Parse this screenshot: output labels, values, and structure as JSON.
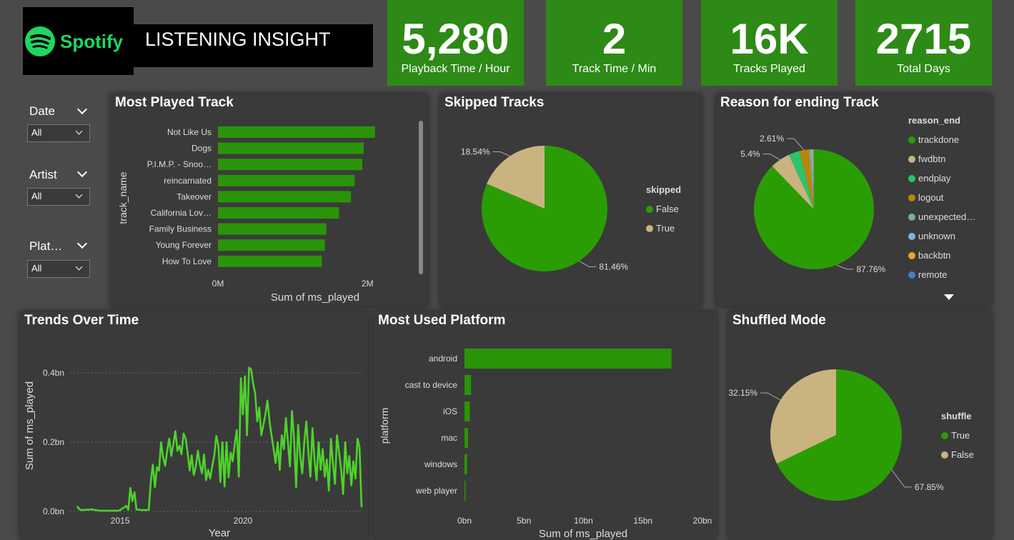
{
  "header": {
    "brand": "Spotify",
    "title": "LISTENING INSIGHT"
  },
  "kpis": [
    {
      "value": "5,280",
      "label": "Playback Time / Hour"
    },
    {
      "value": "2",
      "label": "Track Time / Min"
    },
    {
      "value": "16K",
      "label": "Tracks Played"
    },
    {
      "value": "2715",
      "label": "Total Days"
    }
  ],
  "slicers": [
    {
      "label": "Date",
      "selected": "All"
    },
    {
      "label": "Artist",
      "selected": "All"
    },
    {
      "label": "Plat…",
      "selected": "All"
    }
  ],
  "colors": {
    "primary": "#2d8a16",
    "bar": "#2a9408",
    "line": "#4ed32a",
    "tan": "#c9b37f",
    "panel": "#3a3a3a",
    "background": "#4a4a4a"
  },
  "chart_data": [
    {
      "id": "most-played-track",
      "type": "bar",
      "orientation": "horizontal",
      "title": "Most Played Track",
      "xlabel": "Sum of ms_played",
      "ylabel": "track_name",
      "categories": [
        "Not Like Us",
        "Dogs",
        "P.I.M.P. - Snoo…",
        "reincarnated",
        "Takeover",
        "California Lov…",
        "Family Business",
        "Young Forever",
        "How To Love"
      ],
      "values": [
        2.1,
        1.95,
        1.93,
        1.83,
        1.78,
        1.62,
        1.45,
        1.43,
        1.39
      ],
      "value_unit": "M",
      "xticks": [
        "0M",
        "2M"
      ],
      "xlim": [
        0,
        2.6
      ]
    },
    {
      "id": "skipped-tracks",
      "type": "pie",
      "title": "Skipped Tracks",
      "legend_title": "skipped",
      "labels": [
        "False",
        "True"
      ],
      "values": [
        81.46,
        18.54
      ],
      "display_labels": [
        "81.46%",
        "18.54%"
      ],
      "colors": [
        "#2a9d05",
        "#c9b37f"
      ],
      "legend": "right"
    },
    {
      "id": "reason-for-ending-track",
      "type": "pie",
      "title": "Reason for ending Track",
      "legend_title": "reason_end",
      "labels": [
        "trackdone",
        "fwdbtn",
        "endplay",
        "logout",
        "unexpected…",
        "unknown",
        "backbtn",
        "remote"
      ],
      "values": [
        87.76,
        5.4,
        2.9,
        2.61,
        0.6,
        0.35,
        0.25,
        0.13
      ],
      "display_labels": [
        "87.76%",
        "5.4%",
        "",
        "2.61%",
        "",
        "",
        "",
        ""
      ],
      "colors": [
        "#2a9d05",
        "#c9b37f",
        "#2bc46b",
        "#b8860b",
        "#7fae8f",
        "#7ab7e6",
        "#f0a818",
        "#3f80c7"
      ],
      "legend": "right"
    },
    {
      "id": "trends-over-time",
      "type": "line",
      "title": "Trends Over Time",
      "xlabel": "Year",
      "ylabel": "Sum of ms_played",
      "x_start": 2013.25,
      "x_step": 0.0833,
      "xticks": [
        "2015",
        "2020"
      ],
      "yticks": [
        "0.0bn",
        "0.2bn",
        "0.4bn"
      ],
      "ylim": [
        0,
        0.45
      ],
      "values": [
        0.015,
        0.007,
        0.004,
        0.004,
        0.005,
        0.005,
        0.005,
        0.006,
        0.005,
        0.004,
        0.003,
        0.002,
        0.002,
        0.002,
        0.002,
        0.002,
        0.002,
        0.002,
        0.002,
        0.002,
        0.002,
        0.004,
        0.008,
        0.012,
        0.016,
        0.005,
        0.068,
        0.03,
        0.055,
        0.005,
        0.006,
        0.004,
        0.004,
        0.004,
        0.004,
        0.005,
        0.088,
        0.135,
        0.07,
        0.128,
        0.118,
        0.2,
        0.155,
        0.132,
        0.175,
        0.21,
        0.16,
        0.195,
        0.232,
        0.175,
        0.19,
        0.165,
        0.225,
        0.21,
        0.168,
        0.118,
        0.162,
        0.105,
        0.13,
        0.175,
        0.135,
        0.11,
        0.165,
        0.09,
        0.12,
        0.095,
        0.13,
        0.16,
        0.218,
        0.19,
        0.085,
        0.2,
        0.072,
        0.2,
        0.098,
        0.17,
        0.145,
        0.195,
        0.235,
        0.1,
        0.385,
        0.28,
        0.39,
        0.22,
        0.415,
        0.41,
        0.37,
        0.34,
        0.26,
        0.3,
        0.22,
        0.25,
        0.28,
        0.32,
        0.26,
        0.22,
        0.18,
        0.14,
        0.2,
        0.12,
        0.22,
        0.18,
        0.27,
        0.2,
        0.13,
        0.29,
        0.21,
        0.07,
        0.25,
        0.16,
        0.11,
        0.2,
        0.26,
        0.17,
        0.1,
        0.24,
        0.15,
        0.09,
        0.2,
        0.12,
        0.18,
        0.1,
        0.15,
        0.06,
        0.21,
        0.14,
        0.08,
        0.22,
        0.17,
        0.12,
        0.05,
        0.2,
        0.11,
        0.16,
        0.075,
        0.145,
        0.095,
        0.21,
        0.185,
        0.012
      ],
      "color": "#4ed32a"
    },
    {
      "id": "most-used-platform",
      "type": "bar",
      "orientation": "horizontal",
      "title": "Most Used Platform",
      "xlabel": "Sum of ms_played",
      "ylabel": "platform",
      "categories": [
        "android",
        "cast to device",
        "iOS",
        "mac",
        "windows",
        "web player"
      ],
      "values": [
        17.4,
        0.55,
        0.45,
        0.3,
        0.22,
        0.05
      ],
      "value_unit": "bn",
      "xticks": [
        "0bn",
        "5bn",
        "10bn",
        "15bn",
        "20bn"
      ],
      "xlim": [
        0,
        20
      ]
    },
    {
      "id": "shuffled-mode",
      "type": "pie",
      "title": "Shuffled Mode",
      "legend_title": "shuffle",
      "labels": [
        "True",
        "False"
      ],
      "values": [
        67.85,
        32.15
      ],
      "display_labels": [
        "67.85%",
        "32.15%"
      ],
      "colors": [
        "#2a9d05",
        "#c9b37f"
      ],
      "legend": "right"
    }
  ]
}
